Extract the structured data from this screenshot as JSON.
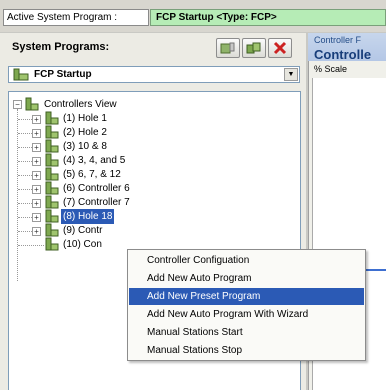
{
  "status_bar": {
    "label": "Active System Program :",
    "value": "FCP Startup   <Type: FCP>"
  },
  "programs_panel": {
    "title": "System Programs:",
    "selected_program": "FCP Startup",
    "toolbar_icons": [
      "add-program-icon",
      "copy-program-icon",
      "delete-program-icon"
    ]
  },
  "tree": {
    "root": "Controllers View",
    "items": [
      {
        "label": "(1) Hole 1"
      },
      {
        "label": "(2) Hole 2"
      },
      {
        "label": "(3) 10 & 8"
      },
      {
        "label": "(4) 3, 4, and 5"
      },
      {
        "label": "(5) 6, 7, & 12"
      },
      {
        "label": "(6) Controller 6"
      },
      {
        "label": "(7) Controller 7"
      },
      {
        "label": "(8) Hole 18"
      },
      {
        "label": "(9) Contr"
      },
      {
        "label": "(10) Con"
      }
    ]
  },
  "context_menu": {
    "items": [
      "Controller Configuation",
      "Add New Auto Program",
      "Add New Preset Program",
      "Add New Auto Program With Wizard",
      "Manual Stations Start",
      "Manual Stations Stop"
    ],
    "highlighted": "Add New Preset Program"
  },
  "right_panel": {
    "subtitle": "Controller F",
    "title": "Controlle",
    "scale_label": "% Scale"
  },
  "colors": {
    "status_value_bg": "#b6ecb6",
    "selection": "#2b5ab5",
    "delete_icon": "#cc2222",
    "node_icon": "#6a8a2a"
  }
}
